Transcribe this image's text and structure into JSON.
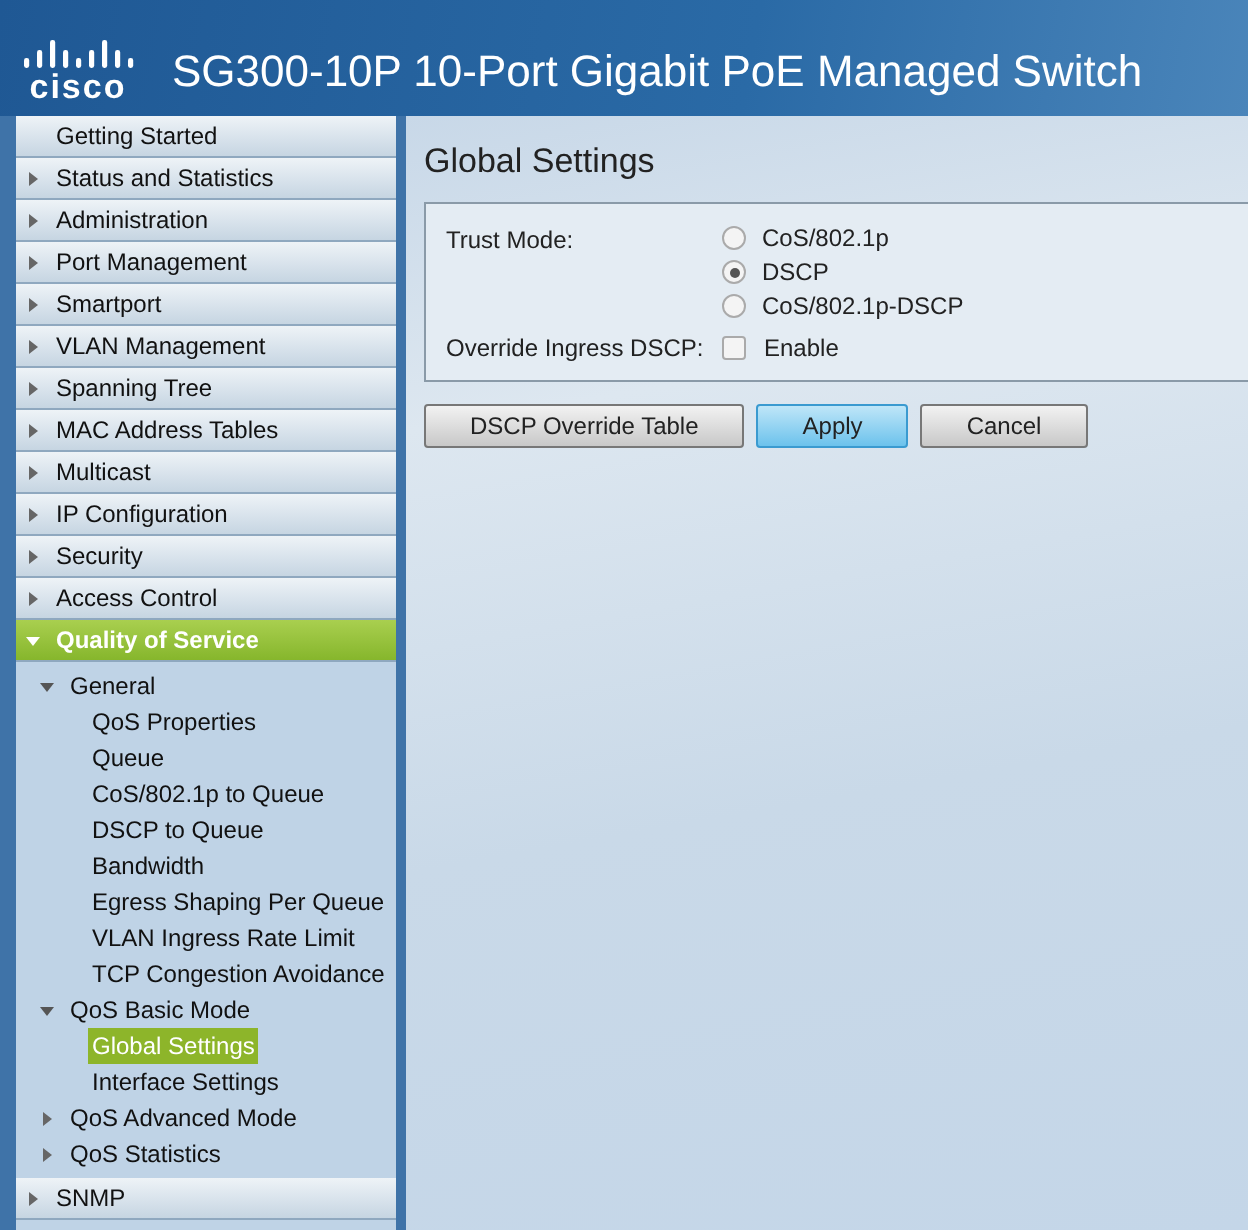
{
  "header": {
    "logo": "cisco",
    "title": "SG300-10P 10-Port Gigabit PoE Managed Switch"
  },
  "sidebar": {
    "items": [
      {
        "label": "Getting Started",
        "expandable": false,
        "expanded": false
      },
      {
        "label": "Status and Statistics",
        "expandable": true,
        "expanded": false
      },
      {
        "label": "Administration",
        "expandable": true,
        "expanded": false
      },
      {
        "label": "Port Management",
        "expandable": true,
        "expanded": false
      },
      {
        "label": "Smartport",
        "expandable": true,
        "expanded": false
      },
      {
        "label": "VLAN Management",
        "expandable": true,
        "expanded": false
      },
      {
        "label": "Spanning Tree",
        "expandable": true,
        "expanded": false
      },
      {
        "label": "MAC Address Tables",
        "expandable": true,
        "expanded": false
      },
      {
        "label": "Multicast",
        "expandable": true,
        "expanded": false
      },
      {
        "label": "IP Configuration",
        "expandable": true,
        "expanded": false
      },
      {
        "label": "Security",
        "expandable": true,
        "expanded": false
      },
      {
        "label": "Access Control",
        "expandable": true,
        "expanded": false
      },
      {
        "label": "Quality of Service",
        "expandable": true,
        "expanded": true,
        "children": [
          {
            "label": "General",
            "expanded": true,
            "children": [
              {
                "label": "QoS Properties",
                "selected": false
              },
              {
                "label": "Queue",
                "selected": false
              },
              {
                "label": "CoS/802.1p to Queue",
                "selected": false
              },
              {
                "label": "DSCP to Queue",
                "selected": false
              },
              {
                "label": "Bandwidth",
                "selected": false
              },
              {
                "label": "Egress Shaping Per Queue",
                "selected": false
              },
              {
                "label": "VLAN Ingress Rate Limit",
                "selected": false
              },
              {
                "label": "TCP Congestion Avoidance",
                "selected": false
              }
            ]
          },
          {
            "label": "QoS Basic Mode",
            "expanded": true,
            "children": [
              {
                "label": "Global Settings",
                "selected": true
              },
              {
                "label": "Interface Settings",
                "selected": false
              }
            ]
          },
          {
            "label": "QoS Advanced Mode",
            "expanded": false
          },
          {
            "label": "QoS Statistics",
            "expanded": false
          }
        ]
      },
      {
        "label": "SNMP",
        "expandable": true,
        "expanded": false
      }
    ]
  },
  "page": {
    "title": "Global Settings",
    "trust_mode": {
      "label": "Trust Mode:",
      "options": [
        {
          "label": "CoS/802.1p",
          "selected": false
        },
        {
          "label": "DSCP",
          "selected": true
        },
        {
          "label": "CoS/802.1p-DSCP",
          "selected": false
        }
      ]
    },
    "override": {
      "label": "Override Ingress DSCP:",
      "option": "Enable",
      "checked": false
    },
    "buttons": [
      {
        "label": "DSCP Override Table",
        "primary": false
      },
      {
        "label": "Apply",
        "primary": true
      },
      {
        "label": "Cancel",
        "primary": false
      }
    ]
  }
}
